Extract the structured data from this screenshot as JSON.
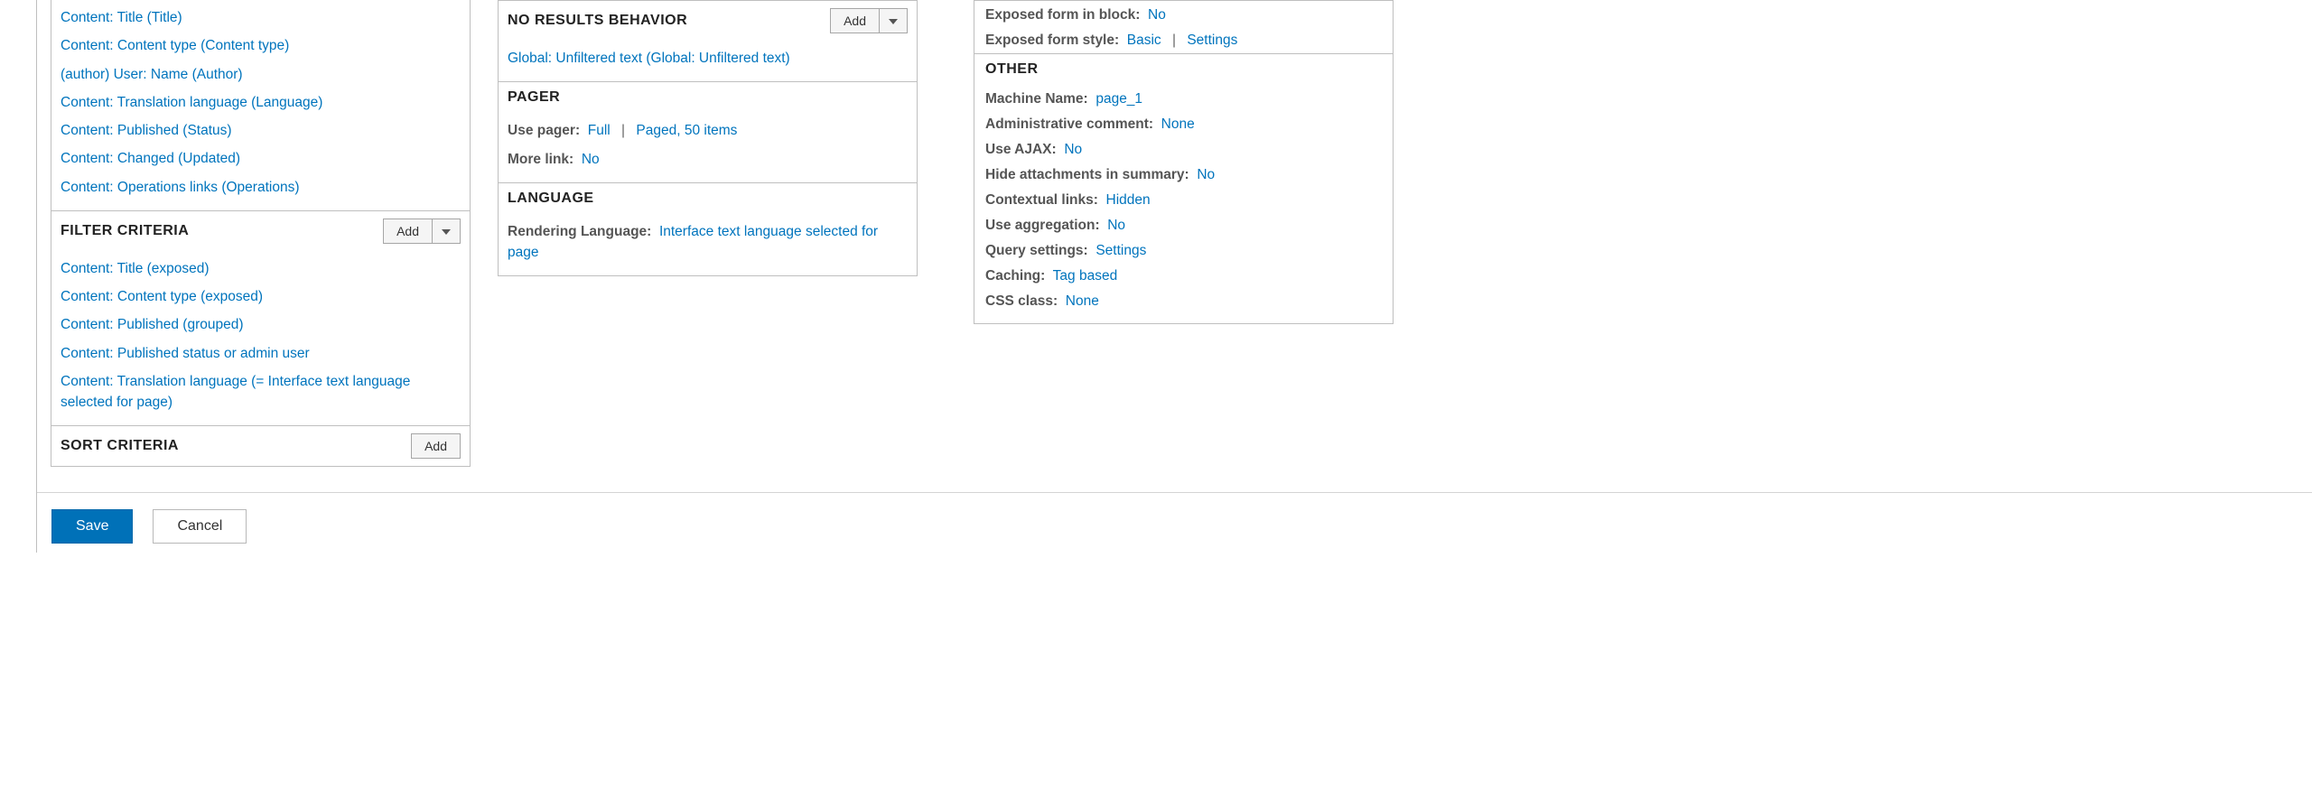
{
  "buttons": {
    "add": "Add",
    "save": "Save",
    "cancel": "Cancel"
  },
  "left": {
    "fields": [
      "Content: Title (Title)",
      "Content: Content type (Content type)",
      "(author) User: Name (Author)",
      "Content: Translation language (Language)",
      "Content: Published (Status)",
      "Content: Changed (Updated)",
      "Content: Operations links (Operations)"
    ],
    "filter_title": "FILTER CRITERIA",
    "filters": [
      "Content: Title (exposed)",
      "Content: Content type (exposed)",
      "Content: Published (grouped)",
      "Content: Published status or admin user",
      "Content: Translation language (= Interface text language selected for page)"
    ],
    "sort_title": "SORT CRITERIA"
  },
  "mid": {
    "no_results_title": "NO RESULTS BEHAVIOR",
    "no_results_item": "Global: Unfiltered text (Global: Unfiltered text)",
    "pager_title": "PAGER",
    "pager_use_label": "Use pager:",
    "pager_use_value": "Full",
    "pager_settings": "Paged, 50 items",
    "more_label": "More link:",
    "more_value": "No",
    "language_title": "LANGUAGE",
    "render_lang_label": "Rendering Language:",
    "render_lang_value": "Interface text language selected for page"
  },
  "right": {
    "exposed_block_label": "Exposed form in block:",
    "exposed_block_value": "No",
    "exposed_style_label": "Exposed form style:",
    "exposed_style_value": "Basic",
    "exposed_style_settings": "Settings",
    "other_title": "OTHER",
    "other": [
      {
        "label": "Machine Name:",
        "value": "page_1"
      },
      {
        "label": "Administrative comment:",
        "value": "None"
      },
      {
        "label": "Use AJAX:",
        "value": "No"
      },
      {
        "label": "Hide attachments in summary:",
        "value": "No"
      },
      {
        "label": "Contextual links:",
        "value": "Hidden"
      },
      {
        "label": "Use aggregation:",
        "value": "No"
      },
      {
        "label": "Query settings:",
        "value": "Settings"
      },
      {
        "label": "Caching:",
        "value": "Tag based"
      },
      {
        "label": "CSS class:",
        "value": "None"
      }
    ]
  }
}
